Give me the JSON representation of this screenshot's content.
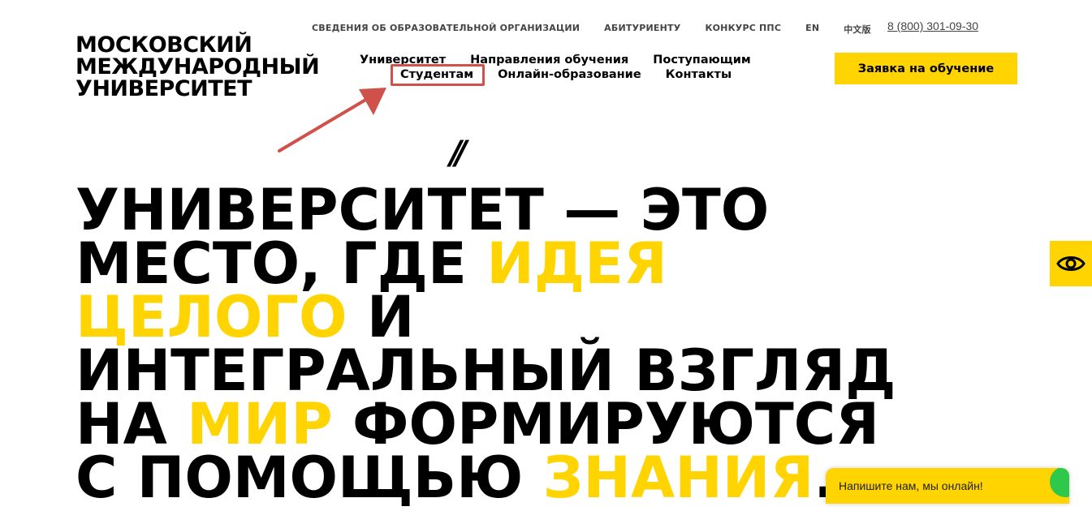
{
  "logo": {
    "line1": "МОСКОВСКИЙ",
    "line2": "МЕЖДУНАРОДНЫЙ",
    "line3": "УНИВЕРСИТЕТ"
  },
  "topnav": [
    {
      "label": "СВЕДЕНИЯ ОБ ОБРАЗОВАТЕЛЬНОЙ ОРГАНИЗАЦИИ"
    },
    {
      "label": "АБИТУРИЕНТУ"
    },
    {
      "label": "КОНКУРС ППС"
    },
    {
      "label": "EN"
    },
    {
      "label": "中文版"
    }
  ],
  "phone": "8 (800) 301-09-30",
  "mainnav": {
    "row1": [
      {
        "label": "Университет"
      },
      {
        "label": "Направления обучения"
      },
      {
        "label": "Поступающим"
      }
    ],
    "row2": [
      {
        "label": "Студентам"
      },
      {
        "label": "Онлайн-образование"
      },
      {
        "label": "Контакты"
      }
    ]
  },
  "cta_label": "Заявка на обучение",
  "slashes": "//",
  "headline": {
    "p1": "УНИВЕРСИТЕТ — ЭТО",
    "p2": "МЕСТО, ГДЕ ",
    "h1": "ИДЕЯ",
    "h2": "ЦЕЛОГО",
    "p3": " И",
    "p4": "ИНТЕГРАЛЬНЫЙ ВЗГЛЯД",
    "p5": "НА ",
    "h3": "МИР",
    "p6": " ФОРМИРУЮТСЯ",
    "p7": "С ПОМОЩЬЮ ",
    "h4": "ЗНАНИЯ",
    "p8": "."
  },
  "chat_text": "Напишите нам, мы онлайн!",
  "icons": {
    "accessibility": "eye-icon",
    "annotation": "arrow-annotation"
  },
  "colors": {
    "accent": "#ffd400",
    "annotation": "#d0504a",
    "online": "#2ec94b"
  }
}
